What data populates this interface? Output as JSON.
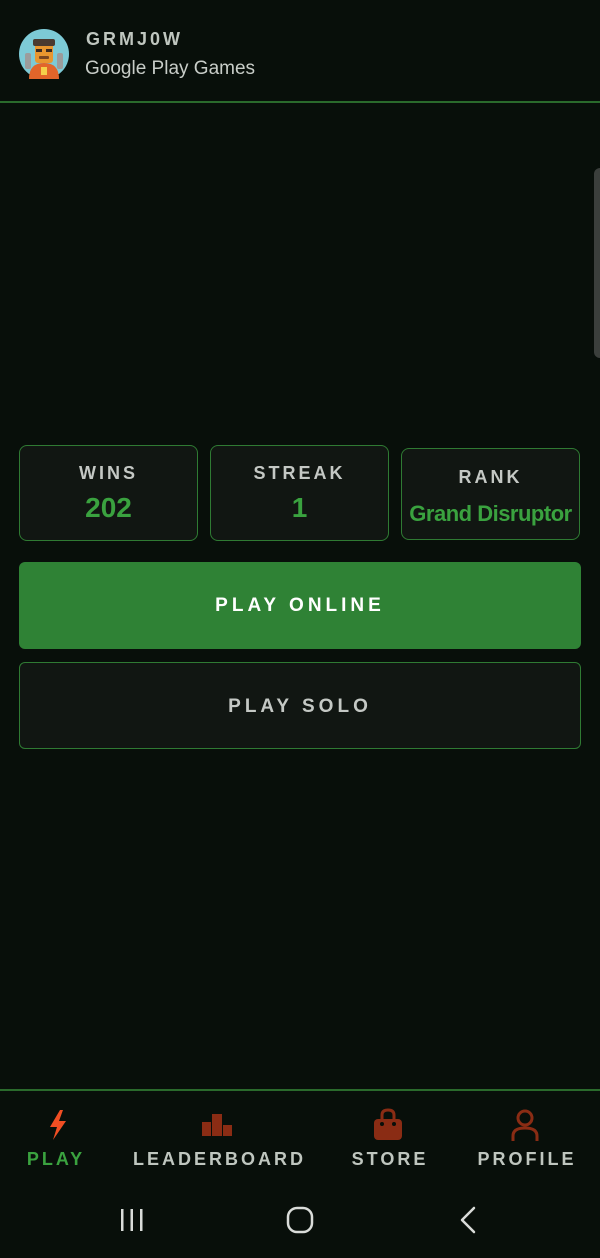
{
  "header": {
    "username": "GRMJ0W",
    "subtitle": "Google Play Games",
    "avatar_icon": "player-avatar-icon"
  },
  "stats": {
    "wins": {
      "label": "WINS",
      "value": "202"
    },
    "streak": {
      "label": "STREAK",
      "value": "1"
    },
    "rank": {
      "label": "RANK",
      "value": "Grand Disruptor"
    }
  },
  "buttons": {
    "play_online": "PLAY ONLINE",
    "play_solo": "PLAY SOLO"
  },
  "bottom_nav": {
    "items": [
      {
        "label": "PLAY",
        "icon": "lightning-bolt-icon",
        "active": true
      },
      {
        "label": "LEADERBOARD",
        "icon": "podium-icon",
        "active": false
      },
      {
        "label": "STORE",
        "icon": "shopping-bag-icon",
        "active": false
      },
      {
        "label": "PROFILE",
        "icon": "person-icon",
        "active": false
      }
    ]
  },
  "system_nav": {
    "recents_icon": "recents-icon",
    "home_icon": "home-icon",
    "back_icon": "back-icon"
  },
  "colors": {
    "background": "#080f0a",
    "accent_green": "#3aa23f",
    "button_green": "#2f8235",
    "border_green": "#2f7a33",
    "nav_icon_orange": "#f04e23",
    "nav_icon_dim": "#8a2c14"
  }
}
